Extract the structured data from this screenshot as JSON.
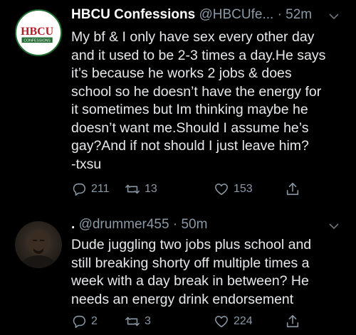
{
  "tweets": [
    {
      "author_name": "HBCU Confessions",
      "handle": "@HBCUfe...",
      "time": "· 52m",
      "avatar": {
        "logo_text": "HBCU",
        "logo_subtext": "CONFESSIONS"
      },
      "lines": [
        "My bf & I only have sex every other day",
        "and it used to be 2-3 times a day.He says",
        "it’s because he works 2 jobs & does",
        "school so he doesn’t have the energy for",
        "it sometimes but Im thinking maybe he",
        "doesn’t want me.Should I assume he’s",
        "gay?And if not should I just leave him?",
        "-txsu"
      ],
      "replies": "211",
      "retweets": "13",
      "likes": "153"
    },
    {
      "author_name": ".",
      "handle": "@drummer455",
      "time": "· 50m",
      "lines": [
        "Dude juggling two jobs plus school and",
        "still breaking shorty off multiple times a",
        "week with a day break in between? He",
        "needs an energy drink endorsement"
      ],
      "replies": "2",
      "retweets": "3",
      "likes": "224"
    }
  ],
  "icons": {
    "menu": "chevron-down-icon",
    "reply": "reply-icon",
    "retweet": "retweet-icon",
    "like": "heart-icon",
    "share": "share-icon"
  },
  "colors": {
    "background": "#000000",
    "text": "#e6e8ea",
    "muted": "#8b98a5",
    "logo_red": "#b3202c",
    "logo_green": "#1f6b30"
  }
}
